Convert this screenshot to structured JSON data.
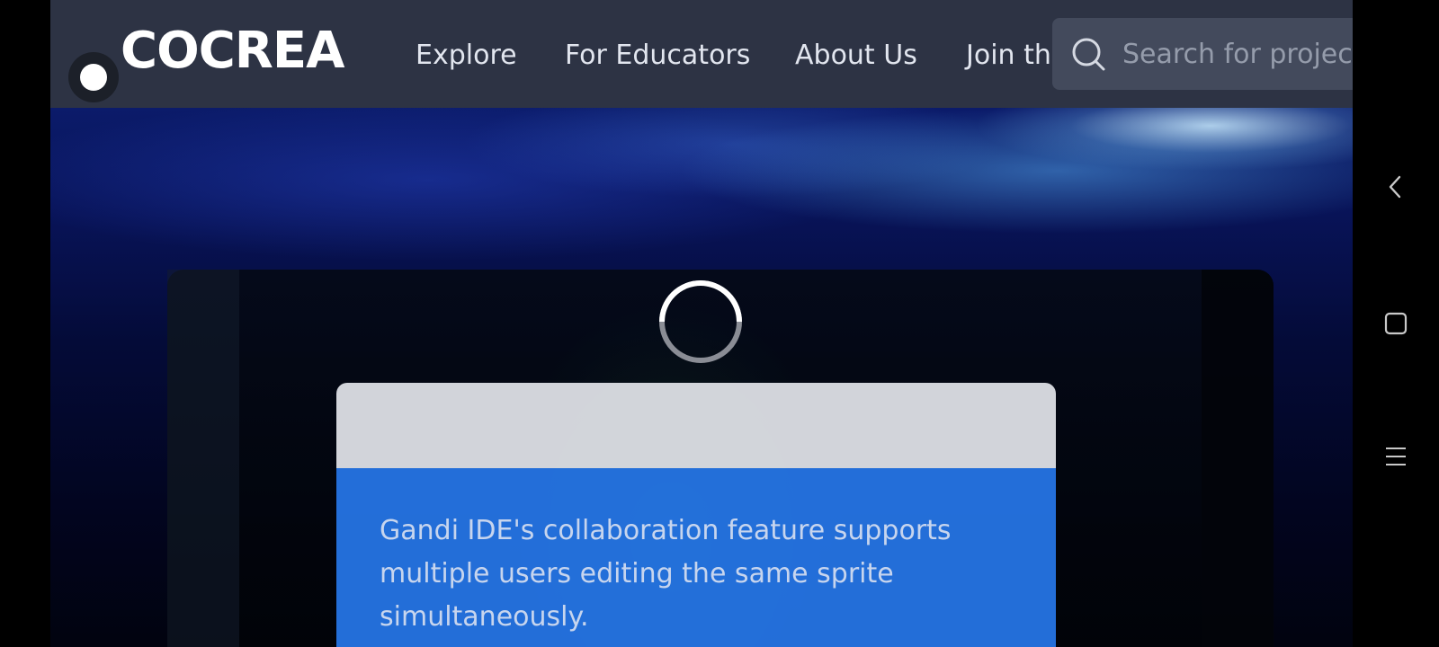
{
  "header": {
    "logo": "COCREA",
    "nav": [
      {
        "label": "Explore"
      },
      {
        "label": "For Educators"
      },
      {
        "label": "About Us"
      },
      {
        "label": "Join the Community"
      }
    ],
    "search": {
      "placeholder": "Search for projects"
    }
  },
  "hero": {
    "loading": true,
    "tip_text": "Gandi IDE's collaboration feature supports multiple users editing the same sprite simultaneously."
  },
  "system_nav": {
    "buttons": [
      "back-icon",
      "recents-icon",
      "menu-icon"
    ]
  },
  "colors": {
    "header_bg": "#2d3344",
    "search_bg": "#434a5c",
    "card_blue": "#2676e8",
    "card_grey": "#e2e4e9"
  }
}
